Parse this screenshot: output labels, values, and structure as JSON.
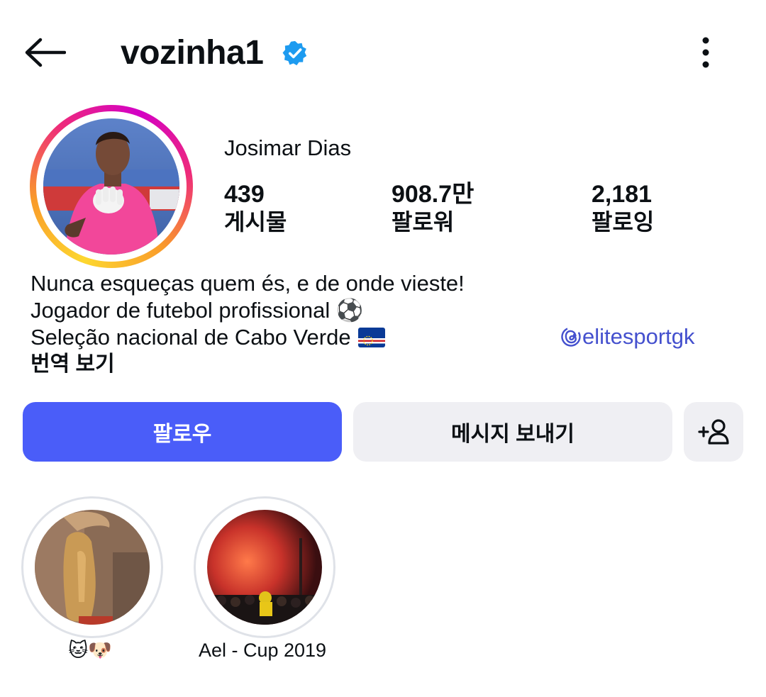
{
  "header": {
    "back_icon": "arrow-left-icon",
    "username": "vozinha1",
    "verified_icon": "verified-badge-icon",
    "verified_color": "#1d9bf0",
    "more_icon": "more-vertical-icon"
  },
  "profile": {
    "full_name": "Josimar Dias",
    "avatar_ring_colors": [
      "#fdd72f",
      "#f99b2a",
      "#ee2a7b",
      "#d300c5"
    ],
    "stats": [
      {
        "value": "439",
        "label": "게시물"
      },
      {
        "value": "908.7만",
        "label": "팔로워"
      },
      {
        "value": "2,181",
        "label": "팔로잉"
      }
    ],
    "bio": [
      "Nunca esqueças quem és, e de onde vieste!",
      "Jogador de futebol profissional ⚽",
      "Seleção nacional de Cabo Verde"
    ],
    "bio_flag_icon": "cape-verde-flag-icon",
    "translate_label": "번역 보기",
    "threads_icon": "threads-icon",
    "threads_handle": "elitesportgk",
    "link_color": "#4450ce"
  },
  "actions": {
    "follow_label": "팔로우",
    "message_label": "메시지 보내기",
    "suggest_icon": "add-person-icon",
    "follow_color": "#4a5df9",
    "secondary_color": "#efeff3"
  },
  "highlights": [
    {
      "label": "🐱🐶"
    },
    {
      "label": "Ael - Cup 2019"
    }
  ]
}
